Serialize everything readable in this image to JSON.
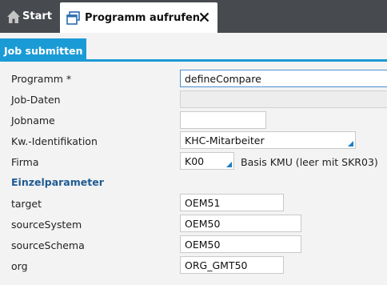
{
  "tabs": {
    "start_label": "Start",
    "active_label": "Programm aufrufen"
  },
  "section_tab": "Job submitten",
  "form": {
    "programm_label": "Programm *",
    "programm_value": "defineCompare",
    "jobdaten_label": "Job-Daten",
    "jobdaten_value": "",
    "jobname_label": "Jobname",
    "jobname_value": "",
    "kw_label": "Kw.-Identifikation",
    "kw_value": "KHC-Mitarbeiter",
    "firma_label": "Firma",
    "firma_value": "K00",
    "firma_hint": "Basis KMU (leer mit SKR03)"
  },
  "params": {
    "heading": "Einzelparameter",
    "rows": [
      {
        "label": "target",
        "value": "OEM51"
      },
      {
        "label": "sourceSystem",
        "value": "OEM50"
      },
      {
        "label": "sourceSchema",
        "value": "OEM50"
      },
      {
        "label": "org",
        "value": "ORG_GMT50"
      }
    ]
  },
  "colors": {
    "tabbar": "#474a4e",
    "accent": "#1b9bd6",
    "section_heading": "#1f5b92"
  },
  "icons": [
    "home-icon",
    "window-icon",
    "close-icon",
    "dropdown-corner-icon"
  ]
}
